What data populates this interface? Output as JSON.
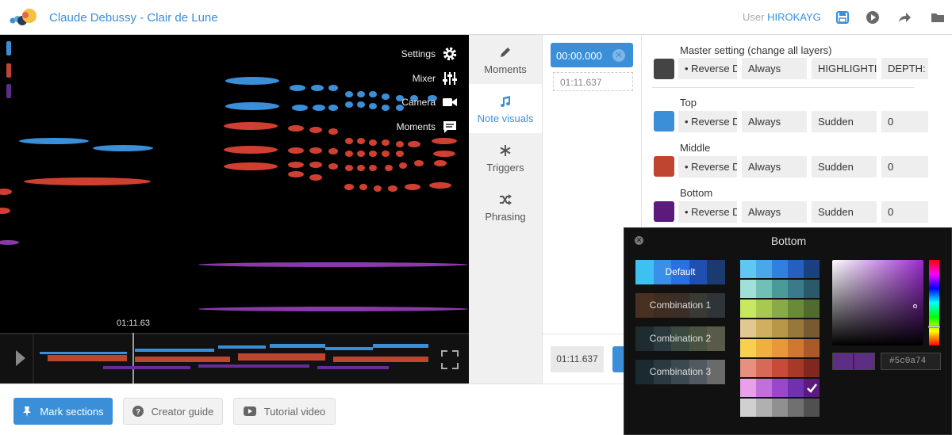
{
  "header": {
    "song_title": "Claude Debussy - Clair de Lune",
    "user_label": "User",
    "username": "HIROKAYG",
    "icons": [
      "save-icon",
      "play-icon",
      "share-icon",
      "folder-icon"
    ]
  },
  "visualizer": {
    "menu": [
      {
        "label": "Settings",
        "icon": "gear-icon"
      },
      {
        "label": "Mixer",
        "icon": "sliders-icon"
      },
      {
        "label": "Camera",
        "icon": "camera-icon"
      },
      {
        "label": "Moments",
        "icon": "chat-icon"
      }
    ],
    "time": "01:11.63",
    "layer_colors": [
      "#3a8fd8",
      "#c04530",
      "#5c2e84"
    ]
  },
  "tabs": [
    {
      "label": "Moments",
      "icon": "pencil-icon",
      "active": false
    },
    {
      "label": "Note visuals",
      "icon": "music-note-icon",
      "active": true
    },
    {
      "label": "Triggers",
      "icon": "snowflake-icon",
      "active": false
    },
    {
      "label": "Phrasing",
      "icon": "shuffle-icon",
      "active": false
    }
  ],
  "moments": {
    "start_time": "00:00.000",
    "end_marker": "01:11.637",
    "current_time": "01:11.637"
  },
  "layers": {
    "master": {
      "label": "Master setting (change all layers)",
      "color": "#444444",
      "shape": "• Reverse D",
      "timing": "Always",
      "effect": "HIGHLIGHTIN",
      "depth": "DEPTH:"
    },
    "items": [
      {
        "name": "Top",
        "color": "#3a8fd8",
        "shape": "• Reverse D",
        "timing": "Always",
        "effect": "Sudden",
        "depth": "0"
      },
      {
        "name": "Middle",
        "color": "#c04530",
        "shape": "• Reverse D",
        "timing": "Always",
        "effect": "Sudden",
        "depth": "0"
      },
      {
        "name": "Bottom",
        "color": "#5c1a7c",
        "shape": "• Reverse D",
        "timing": "Always",
        "effect": "Sudden",
        "depth": "0"
      }
    ]
  },
  "color_picker": {
    "title": "Bottom",
    "combinations": [
      {
        "label": "Default",
        "selected": true,
        "cells": [
          "#3ec0f0",
          "#3a90e8",
          "#2a70e0",
          "#1f4fb0",
          "#1a3a70"
        ]
      },
      {
        "label": "Combination 1",
        "selected": false,
        "cells": [
          "#4a3020",
          "#3f2c22",
          "#3a2e28",
          "#3a3a34",
          "#2e3438"
        ]
      },
      {
        "label": "Combination 2",
        "selected": false,
        "cells": [
          "#1e2c30",
          "#2a3a3e",
          "#3a4a40",
          "#4a5240",
          "#5a5a48"
        ]
      },
      {
        "label": "Combination 3",
        "selected": false,
        "cells": [
          "#1a2a30",
          "#2a3a40",
          "#3a4a50",
          "#505a60",
          "#6a6a6a"
        ]
      }
    ],
    "palette": [
      [
        "#5ec8f0",
        "#4aa8ea",
        "#2f80e0",
        "#2460c0",
        "#1a4080"
      ],
      [
        "#a0e0d8",
        "#70c0b8",
        "#4a9a9a",
        "#3a7a8a",
        "#2a5a6a"
      ],
      [
        "#c8e860",
        "#a8c850",
        "#8aaa48",
        "#6a8a3a",
        "#506a30"
      ],
      [
        "#e0c890",
        "#d0b060",
        "#b89848",
        "#98783a",
        "#785a30"
      ],
      [
        "#f8d050",
        "#f0b040",
        "#e89838",
        "#d07830",
        "#a85a28"
      ],
      [
        "#e89080",
        "#d86858",
        "#c84a38",
        "#a83828",
        "#802820"
      ],
      [
        "#e8a0e8",
        "#c070d8",
        "#9848c8",
        "#7030b0",
        "#5c1a7c"
      ],
      [
        "#d0d0d0",
        "#b0b0b0",
        "#909090",
        "#707070",
        "#505050"
      ]
    ],
    "selected_swatch": "#5c1a7c",
    "hex_value": "#5c0a74"
  },
  "footer": {
    "mark_sections": "Mark sections",
    "creator_guide": "Creator guide",
    "tutorial_video": "Tutorial video"
  }
}
